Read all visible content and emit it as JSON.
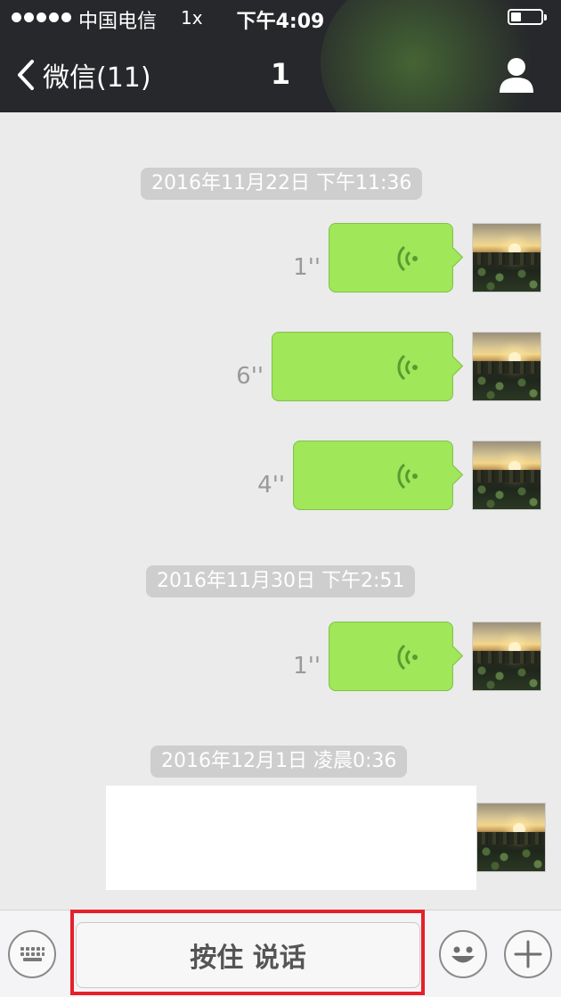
{
  "status_bar": {
    "carrier": "中国电信",
    "network": "1x",
    "time": "下午4:09",
    "battery_level": 0.35
  },
  "nav": {
    "back_label": "微信(11)",
    "title": "1",
    "back_icon": "chevron-left-icon",
    "profile_icon": "person-icon"
  },
  "messages": {
    "timestamps": [
      "2016年11月22日 下午11:36",
      "2016年11月30日 下午2:51",
      "2016年12月1日 凌晨0:36"
    ],
    "voice": [
      {
        "duration": "1''"
      },
      {
        "duration": "6''"
      },
      {
        "duration": "4''"
      },
      {
        "duration": "1''"
      }
    ]
  },
  "input_bar": {
    "hold_to_talk": "按住 说话",
    "keyboard_icon": "keyboard-icon",
    "emoji_icon": "smiley-icon",
    "plus_icon": "plus-icon"
  },
  "colors": {
    "bubble_green": "#a0e759",
    "nav_bg": "#27282b",
    "highlight_red": "#e5202b"
  }
}
